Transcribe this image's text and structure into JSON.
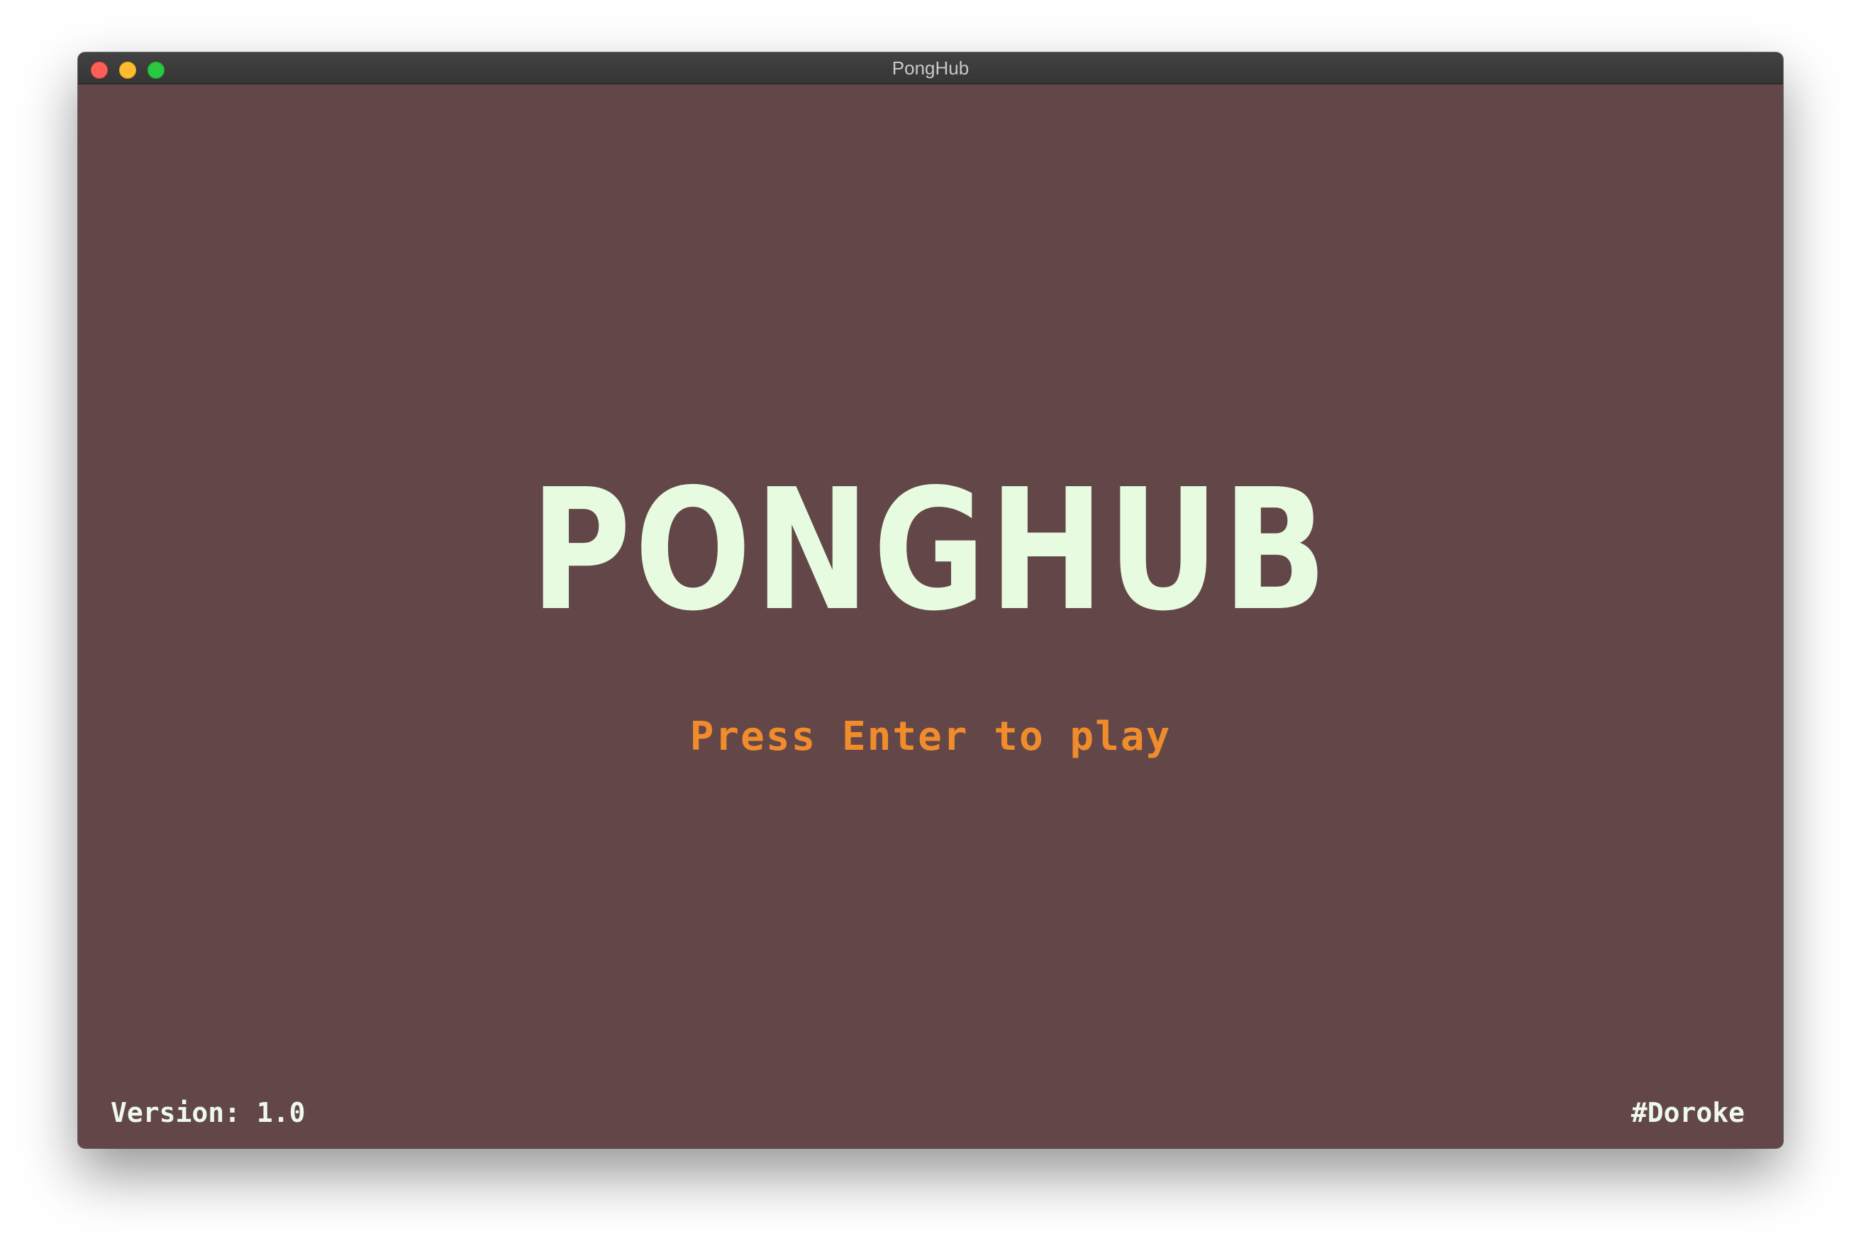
{
  "window": {
    "title": "PongHub",
    "controls": {
      "close_icon": "close-icon",
      "minimize_icon": "minimize-icon",
      "maximize_icon": "maximize-icon"
    }
  },
  "game": {
    "title": "PONGHUB",
    "prompt": "Press Enter to play",
    "version": "Version: 1.0",
    "author": "#Doroke"
  },
  "colors": {
    "background": "#634748",
    "title": "#e6fbe0",
    "prompt": "#f08c2c",
    "footer_text": "#eef8ec"
  }
}
